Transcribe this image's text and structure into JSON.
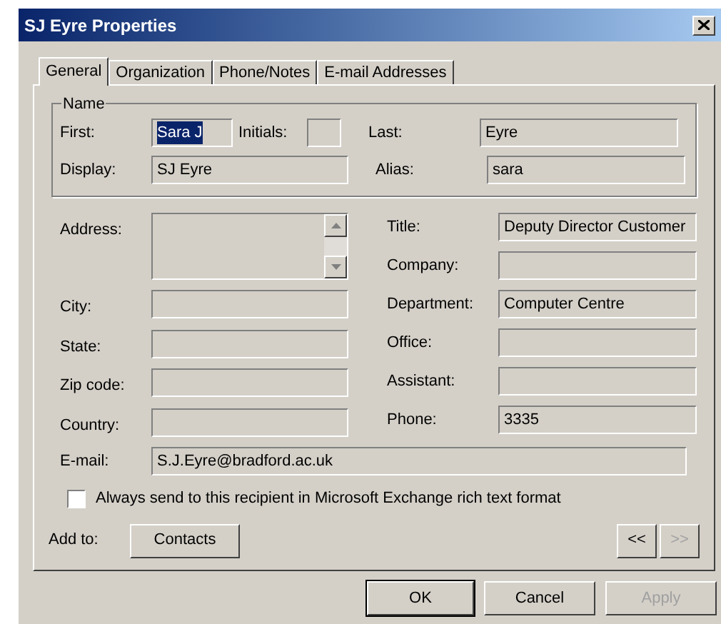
{
  "window": {
    "title": "SJ Eyre Properties"
  },
  "tabs": [
    {
      "label": "General",
      "selected": true
    },
    {
      "label": "Organization",
      "selected": false
    },
    {
      "label": "Phone/Notes",
      "selected": false
    },
    {
      "label": "E-mail Addresses",
      "selected": false
    }
  ],
  "name_group": {
    "legend": "Name",
    "first": {
      "label": "First:",
      "value": "Sara J",
      "highlighted": true
    },
    "initials": {
      "label": "Initials:"
    },
    "last": {
      "label": "Last:",
      "value": "Eyre"
    },
    "display": {
      "label": "Display:",
      "value": "SJ Eyre"
    },
    "alias": {
      "label": "Alias:",
      "value": "sara"
    }
  },
  "left_fields": [
    {
      "label": "Address:",
      "kind": "multiline"
    },
    {
      "label": "City:",
      "kind": "text"
    },
    {
      "label": "State:",
      "kind": "text"
    },
    {
      "label": "Zip code:",
      "kind": "text"
    },
    {
      "label": "Country:",
      "kind": "text"
    }
  ],
  "right_fields": [
    {
      "label": "Title:",
      "value": "Deputy Director Customer"
    },
    {
      "label": "Company:"
    },
    {
      "label": "Department:",
      "value": "Computer Centre"
    },
    {
      "label": "Office:"
    },
    {
      "label": "Assistant:"
    },
    {
      "label": "Phone:",
      "value": "3335"
    }
  ],
  "email": {
    "label": "E-mail:",
    "value": "S.J.Eyre@bradford.ac.uk"
  },
  "rich_text_checkbox": {
    "label": "Always send to this recipient in Microsoft Exchange rich text format",
    "checked": false
  },
  "add_to": {
    "label": "Add to:",
    "button": "Contacts"
  },
  "nav_buttons": [
    {
      "label": "<<",
      "disabled": false
    },
    {
      "label": ">>",
      "disabled": true
    }
  ],
  "buttons": [
    {
      "label": "OK",
      "disabled": false,
      "default": true
    },
    {
      "label": "Cancel",
      "disabled": false,
      "default": false
    },
    {
      "label": "Apply",
      "disabled": true,
      "default": false
    }
  ]
}
